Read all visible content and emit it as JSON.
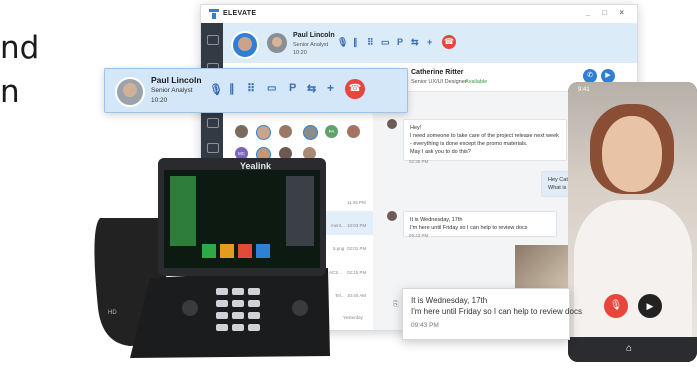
{
  "hero": {
    "line1": "nd",
    "line2": "n"
  },
  "app": {
    "brand": "ELEVATE",
    "window_controls": "_ □ ×"
  },
  "callbar": {
    "caller_name": "Paul Lincoln",
    "caller_title": "Senior Analyst",
    "duration": "10:20"
  },
  "floating_call": {
    "caller_name": "Paul Lincoln",
    "caller_title": "Senior Analyst",
    "duration": "10:20"
  },
  "controls": [
    "mic-icon",
    "pause-icon",
    "keypad-icon",
    "screen-icon",
    "park-icon",
    "transfer-icon",
    "add-call-icon",
    "hangup-icon"
  ],
  "chat_header": {
    "name": "Catherine Ritter",
    "title": "Senior UX/UI Designer",
    "status": "Available"
  },
  "messages": [
    {
      "text": "Hey!\nI need someone to take care of the project release next week - everything is done except the promo materials.\nMay I ask you to do this?",
      "time": "02:35 PM"
    },
    {
      "text": "Hey Cath\nWhat is th",
      "time": ""
    },
    {
      "text": "It is Wednesday, 17th\nI'm here until Friday so I can help to review docs",
      "time": "09:43 PM"
    }
  ],
  "list_times": [
    "11:45 PM",
    "10:03 PM",
    "02:01 PM",
    "02:15 PM",
    "10:40 AM",
    "Yesterday"
  ],
  "list_snippets": [
    "ment...",
    "5.png",
    "ACS...",
    "Tel..."
  ],
  "avatar_initials": [
    "PA",
    "MC"
  ],
  "popup": {
    "line1": "It is Wednesday, 17th",
    "line2": "I'm here until Friday so I can help to review docs",
    "time": "09:43 PM"
  },
  "phone": {
    "clock": "9:41"
  },
  "deskphone": {
    "brand": "Yealink",
    "badge": "HD"
  },
  "colors": {
    "accent": "#2f7fd6",
    "hangup": "#e8453c",
    "callbar": "#d3e7f8",
    "rail": "#333a44"
  }
}
